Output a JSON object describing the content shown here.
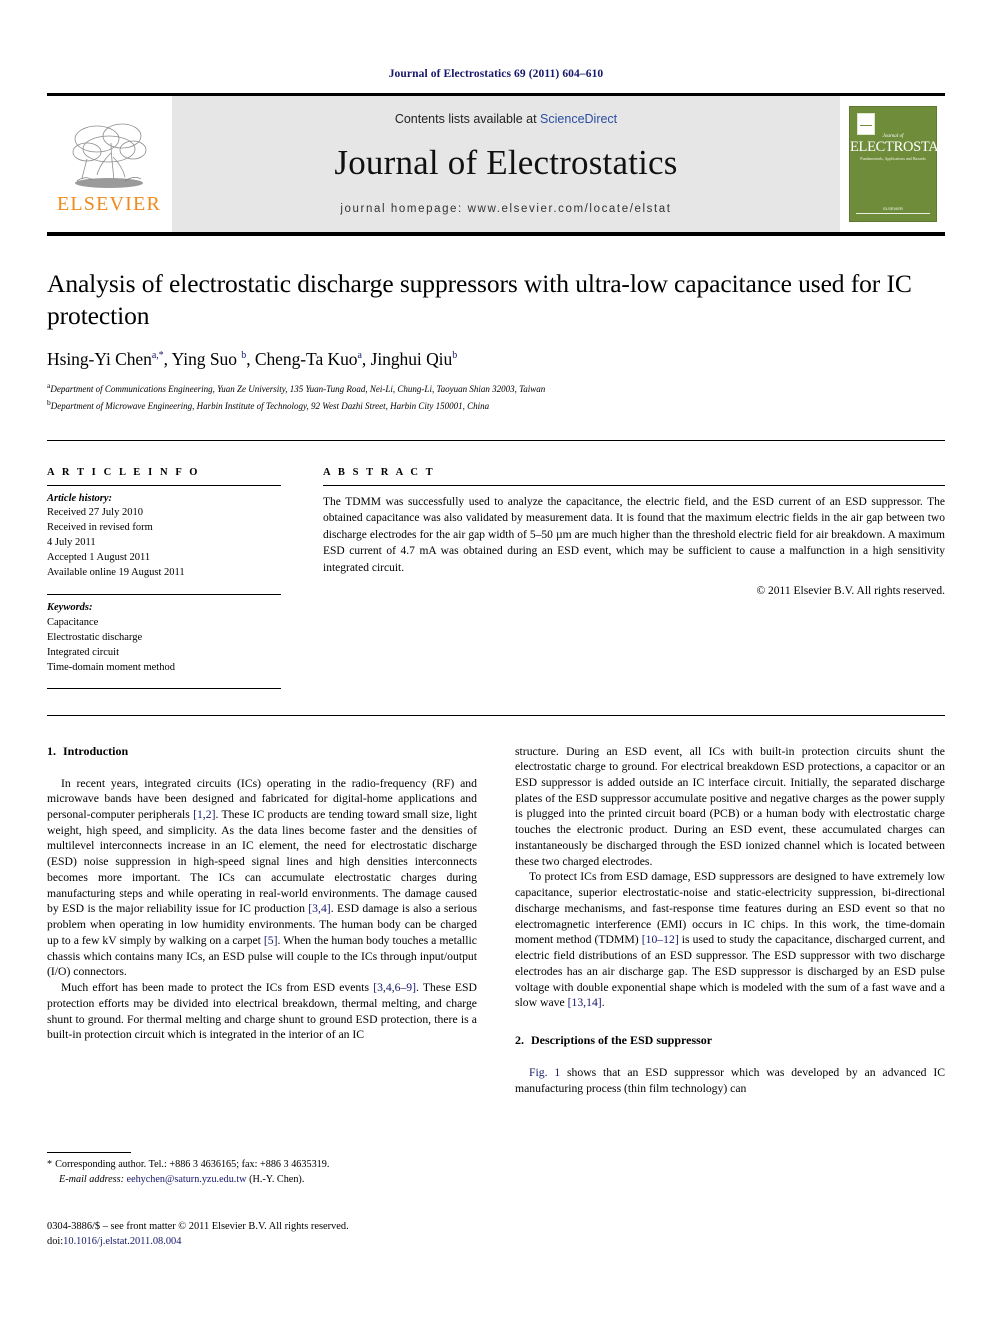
{
  "running_head": "Journal of Electrostatics 69 (2011) 604–610",
  "masthead": {
    "publisher_logo_text": "ELSEVIER",
    "contents_prefix": "Contents lists available at ",
    "contents_link": "ScienceDirect",
    "journal_title": "Journal of Electrostatics",
    "homepage": "journal homepage: www.elsevier.com/locate/elstat",
    "cover": {
      "journal_of": "Journal of",
      "title": "ELECTROSTATICS",
      "subtitle": "Fundamentals, Applications and Hazards",
      "publisher": "ELSEVIER"
    }
  },
  "article": {
    "title": "Analysis of electrostatic discharge suppressors with ultra-low capacitance used for IC protection",
    "authors": [
      {
        "name": "Hsing-Yi Chen",
        "sup": "a,*"
      },
      {
        "name": "Ying Suo",
        "sup": "b"
      },
      {
        "name": "Cheng-Ta Kuo",
        "sup": "a"
      },
      {
        "name": "Jinghui Qiu",
        "sup": "b"
      }
    ],
    "affiliations": [
      {
        "marker": "a",
        "text": "Department of Communications Engineering, Yuan Ze University, 135 Yuan-Tung Road, Nei-Li, Chung-Li, Taoyuan Shian 32003, Taiwan"
      },
      {
        "marker": "b",
        "text": "Department of Microwave Engineering, Harbin Institute of Technology, 92 West Dazhi Street, Harbin City 150001, China"
      }
    ]
  },
  "article_info": {
    "label": "A R T I C L E   I N F O",
    "history_heading": "Article history:",
    "history": [
      "Received 27 July 2010",
      "Received in revised form",
      "4 July 2011",
      "Accepted 1 August 2011",
      "Available online 19 August 2011"
    ],
    "keywords_heading": "Keywords:",
    "keywords": [
      "Capacitance",
      "Electrostatic discharge",
      "Integrated circuit",
      "Time-domain moment method"
    ]
  },
  "abstract": {
    "label": "A B S T R A C T",
    "text": "The TDMM was successfully used to analyze the capacitance, the electric field, and the ESD current of an ESD suppressor. The obtained capacitance was also validated by measurement data. It is found that the maximum electric fields in the air gap between two discharge electrodes for the air gap width of 5–50 µm are much higher than the threshold electric field for air breakdown. A maximum ESD current of 4.7 mA was obtained during an ESD event, which may be sufficient to cause a malfunction in a high sensitivity integrated circuit.",
    "copyright": "© 2011 Elsevier B.V. All rights reserved."
  },
  "sections": {
    "intro_number": "1.",
    "intro_title": "Introduction",
    "desc_number": "2.",
    "desc_title": "Descriptions of the ESD suppressor"
  },
  "body": {
    "left_p1_a": "In recent years, integrated circuits (ICs) operating in the radio-frequency (RF) and microwave bands have been designed and fabricated for digital-home applications and personal-computer peripherals ",
    "left_p1_ref1": "[1,2]",
    "left_p1_b": ". These IC products are tending toward small size, light weight, high speed, and simplicity. As the data lines become faster and the densities of multilevel interconnects increase in an IC element, the need for electrostatic discharge (ESD) noise suppression in high-speed signal lines and high densities interconnects becomes more important. The ICs can accumulate electrostatic charges during manufacturing steps and while operating in real-world environments. The damage caused by ESD is the major reliability issue for IC production ",
    "left_p1_ref2": "[3,4]",
    "left_p1_c": ". ESD damage is also a serious problem when operating in low humidity environments. The human body can be charged up to a few kV simply by walking on a carpet ",
    "left_p1_ref3": "[5]",
    "left_p1_d": ". When the human body touches a metallic chassis which contains many ICs, an ESD pulse will couple to the ICs through input/output (I/O) connectors.",
    "left_p2_a": "Much effort has been made to protect the ICs from ESD events ",
    "left_p2_ref1": "[3,4,6–9]",
    "left_p2_b": ". These ESD protection efforts may be divided into electrical breakdown, thermal melting, and charge shunt to ground. For thermal melting and charge shunt to ground ESD protection, there is a built-in protection circuit which is integrated in the interior of an IC",
    "right_p1": "structure. During an ESD event, all ICs with built-in protection circuits shunt the electrostatic charge to ground. For electrical breakdown ESD protections, a capacitor or an ESD suppressor is added outside an IC interface circuit. Initially, the separated discharge plates of the ESD suppressor accumulate positive and negative charges as the power supply is plugged into the printed circuit board (PCB) or a human body with electrostatic charge touches the electronic product. During an ESD event, these accumulated charges can instantaneously be discharged through the ESD ionized channel which is located between these two charged electrodes.",
    "right_p2_a": "To protect ICs from ESD damage, ESD suppressors are designed to have extremely low capacitance, superior electrostatic-noise and static-electricity suppression, bi-directional discharge mechanisms, and fast-response time features during an ESD event so that no electromagnetic interference (EMI) occurs in IC chips. In this work, the time-domain moment method (TDMM) ",
    "right_p2_ref1": "[10–12]",
    "right_p2_b": " is used to study the capacitance, discharged current, and electric field distributions of an ESD suppressor. The ESD suppressor with two discharge electrodes has an air discharge gap. The ESD suppressor is discharged by an ESD pulse voltage with double exponential shape which is modeled with the sum of a fast wave and a slow wave ",
    "right_p2_ref2": "[13,14]",
    "right_p2_c": ".",
    "right_p3_ref": "Fig. 1",
    "right_p3_text": " shows that an ESD suppressor which was developed by an advanced IC manufacturing process (thin film technology) can"
  },
  "footnote": {
    "star": "*",
    "corresponding": "Corresponding author. Tel.: +886 3 4636165; fax: +886 3 4635319.",
    "email_label": "E-mail address:",
    "email": "eehychen@saturn.yzu.edu.tw",
    "email_owner": "(H.-Y. Chen)."
  },
  "footer": {
    "issn_line": "0304-3886/$ – see front matter © 2011 Elsevier B.V. All rights reserved.",
    "doi_label": "doi:",
    "doi": "10.1016/j.elstat.2011.08.004"
  },
  "colors": {
    "link_blue": "#16176b",
    "sciencedirect_blue": "#2b4ea2",
    "elsevier_orange": "#f08a1b",
    "cover_green": "#6f8c3a",
    "banner_gray": "#e6e6e6"
  }
}
